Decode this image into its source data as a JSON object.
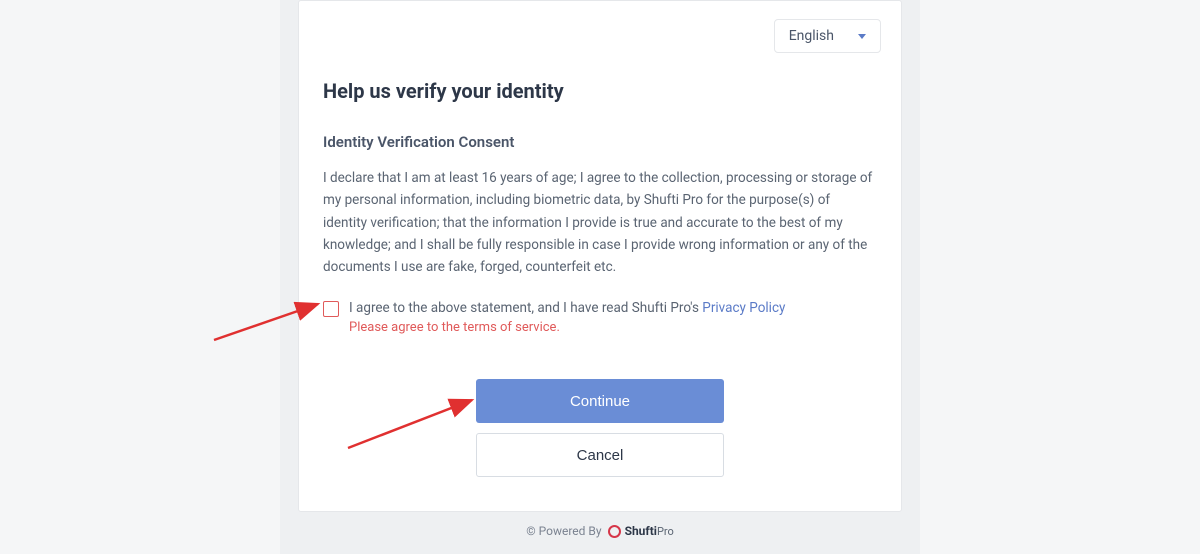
{
  "header": {
    "language": "English"
  },
  "main": {
    "title": "Help us verify your identity",
    "section_heading": "Identity Verification Consent",
    "consent_paragraph": "I declare that I am at least 16 years of age; I agree to the collection, processing or storage of my personal information, including biometric data, by Shufti Pro for the purpose(s) of identity verification; that the information I provide is true and accurate to the best of my knowledge; and I shall be fully responsible in case I provide wrong information or any of the documents I use are fake, forged, counterfeit etc.",
    "agree_prefix": "I agree to the above statement, and I have read Shufti Pro's ",
    "privacy_link_label": "Privacy Policy",
    "error_message": "Please agree to the terms of service.",
    "continue_label": "Continue",
    "cancel_label": "Cancel"
  },
  "footer": {
    "powered_by": "© Powered By",
    "brand_bold": "Shufti",
    "brand_light": "Pro"
  }
}
